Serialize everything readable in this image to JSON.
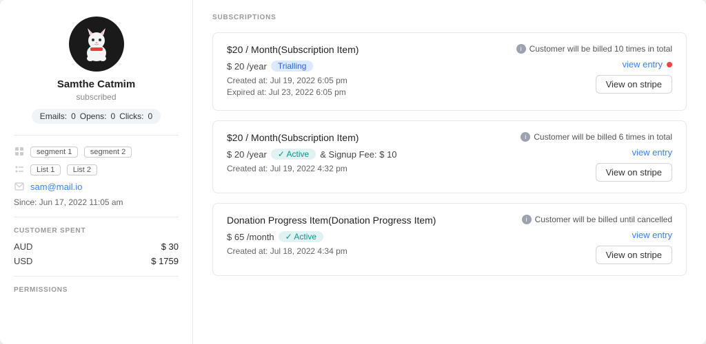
{
  "sidebar": {
    "user": {
      "name": "Samthe Catmim",
      "status": "subscribed"
    },
    "stats": {
      "emails_label": "Emails:",
      "emails_value": "0",
      "opens_label": "Opens:",
      "opens_value": "0",
      "clicks_label": "Clicks:",
      "clicks_value": "0"
    },
    "segments": [
      "segment 1",
      "segment 2"
    ],
    "lists": [
      "List 1",
      "List 2"
    ],
    "email": "sam@mail.io",
    "since": "Since: Jun 17, 2022 11:05 am",
    "customer_spent_label": "CUSTOMER SPENT",
    "currencies": [
      {
        "code": "AUD",
        "amount": "$ 30"
      },
      {
        "code": "USD",
        "amount": "$ 1759"
      }
    ],
    "permissions_label": "PERMISSIONS"
  },
  "main": {
    "subscriptions_label": "SUBSCRIPTIONS",
    "cards": [
      {
        "title": "$20 / Month(Subscription Item)",
        "price": "$ 20 /year",
        "badge_type": "trialling",
        "badge_text": "Trialling",
        "created": "Created at: Jul 19, 2022 6:05 pm",
        "expired": "Expired at: Jul 23, 2022 6:05 pm",
        "billing_info": "Customer will be billed 10 times in total",
        "view_entry_label": "view entry",
        "view_stripe_label": "View on stripe",
        "has_red_dot": true,
        "signup_fee": null
      },
      {
        "title": "$20 / Month(Subscription Item)",
        "price": "$ 20 /year",
        "badge_type": "active",
        "badge_text": "Active",
        "created": "Created at: Jul 19, 2022 4:32 pm",
        "expired": null,
        "billing_info": "Customer will be billed 6 times in total",
        "view_entry_label": "view entry",
        "view_stripe_label": "View on stripe",
        "has_red_dot": false,
        "signup_fee": "& Signup Fee: $ 10"
      },
      {
        "title": "Donation Progress Item(Donation Progress Item)",
        "price": "$ 65 /month",
        "badge_type": "active",
        "badge_text": "Active",
        "created": "Created at: Jul 18, 2022 4:34 pm",
        "expired": null,
        "billing_info": "Customer will be billed until cancelled",
        "view_entry_label": "view entry",
        "view_stripe_label": "View on stripe",
        "has_red_dot": false,
        "signup_fee": null
      }
    ]
  }
}
